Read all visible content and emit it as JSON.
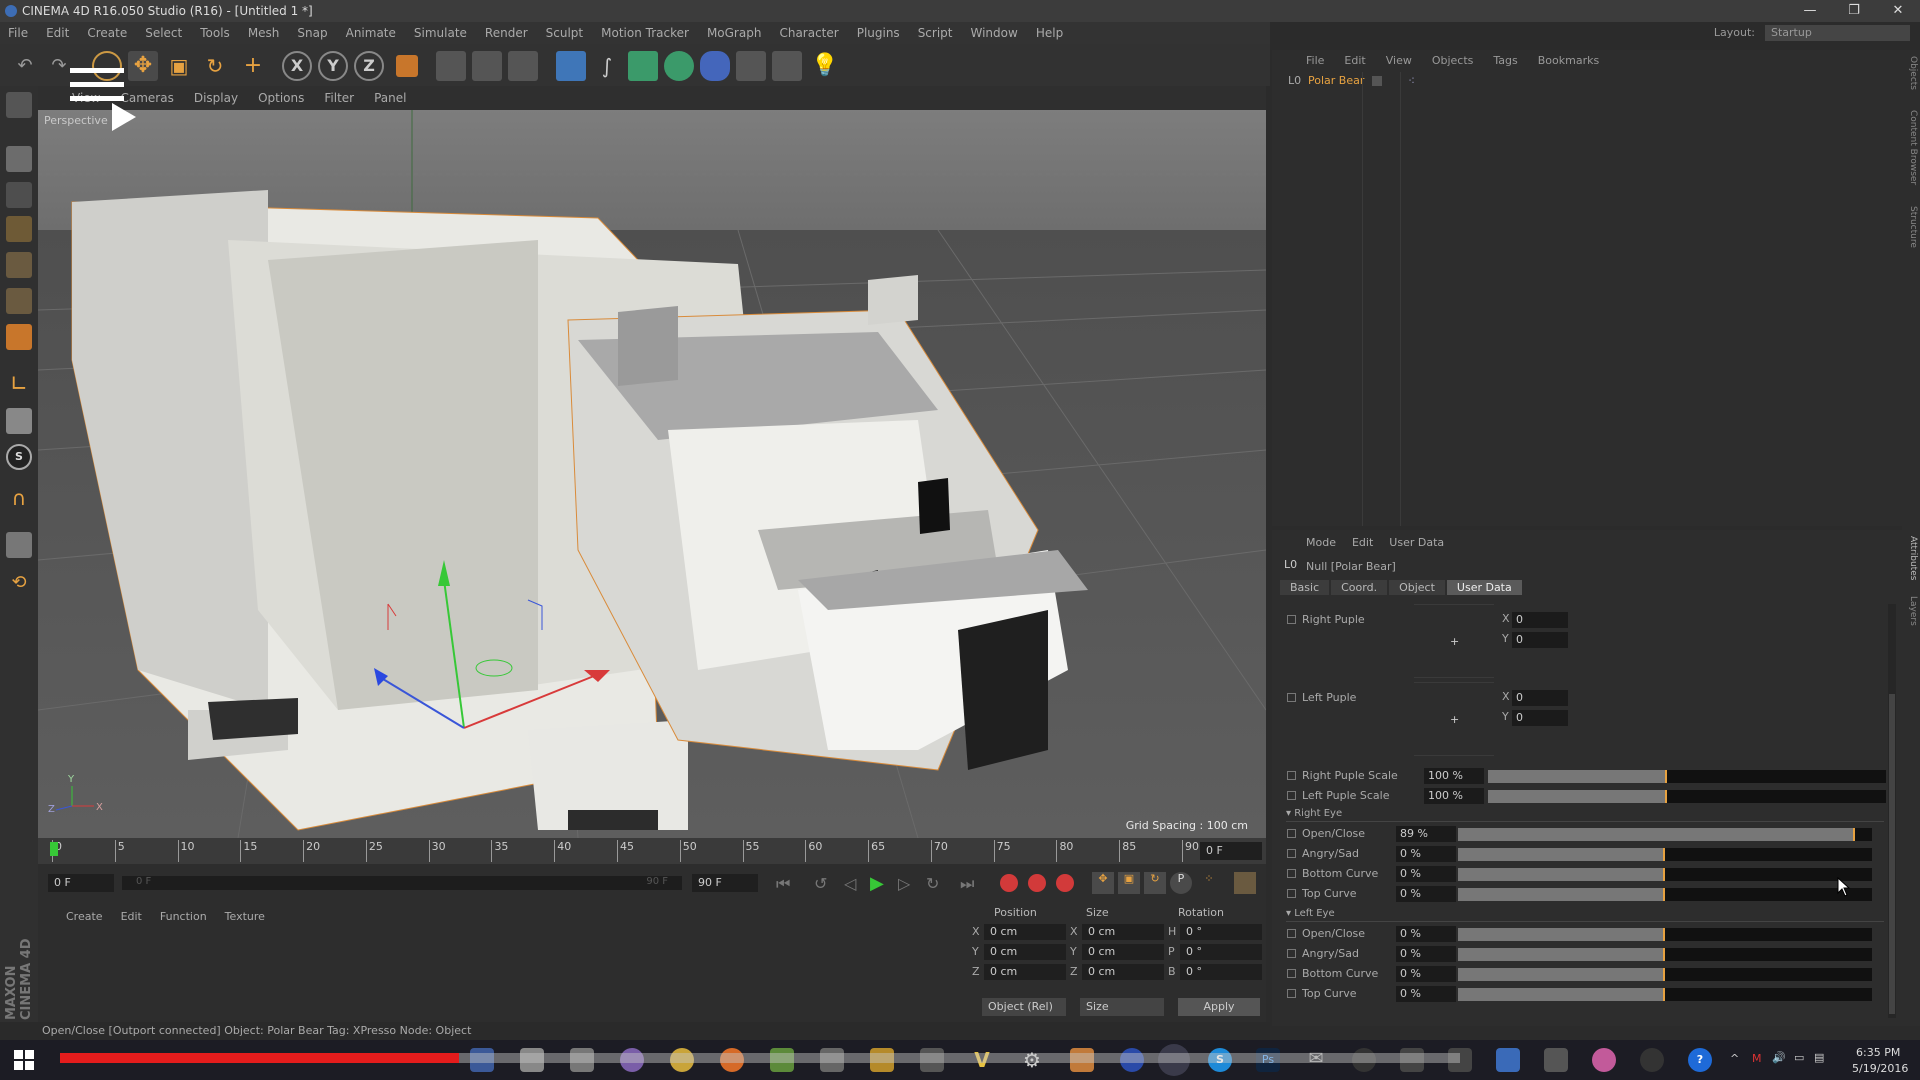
{
  "window": {
    "title": "CINEMA 4D R16.050 Studio (R16) - [Untitled 1 *]",
    "controls": [
      "—",
      "❐",
      "✕"
    ]
  },
  "menubar": [
    "File",
    "Edit",
    "Create",
    "Select",
    "Tools",
    "Mesh",
    "Snap",
    "Animate",
    "Simulate",
    "Render",
    "Sculpt",
    "Motion Tracker",
    "MoGraph",
    "Character",
    "Plugins",
    "Script",
    "Window",
    "Help"
  ],
  "layout": {
    "label": "Layout:",
    "value": "Startup"
  },
  "toolbar_axes": [
    "X",
    "Y",
    "Z"
  ],
  "viewport": {
    "menu": [
      "View",
      "Cameras",
      "Display",
      "Options",
      "Filter",
      "Panel"
    ],
    "label": "Perspective",
    "grid_spacing": "Grid Spacing : 100 cm",
    "axis_labels": [
      "Y",
      "Z",
      "X"
    ]
  },
  "timeline": {
    "ticks": [
      "0",
      "5",
      "10",
      "15",
      "20",
      "25",
      "30",
      "35",
      "40",
      "45",
      "50",
      "55",
      "60",
      "65",
      "70",
      "75",
      "80",
      "85",
      "90"
    ],
    "current_frame": "0 F",
    "start_field": "0 F",
    "min_field": "0 F",
    "max_field": "90 F",
    "end_field": "90 F"
  },
  "material_menu": [
    "Create",
    "Edit",
    "Function",
    "Texture"
  ],
  "coords": {
    "headers": [
      "Position",
      "Size",
      "Rotation"
    ],
    "rows": [
      {
        "axis": "X",
        "pos": "0 cm",
        "size_axis": "X",
        "size": "0 cm",
        "rot_axis": "H",
        "rot": "0 °"
      },
      {
        "axis": "Y",
        "pos": "0 cm",
        "size_axis": "Y",
        "size": "0 cm",
        "rot_axis": "P",
        "rot": "0 °"
      },
      {
        "axis": "Z",
        "pos": "0 cm",
        "size_axis": "Z",
        "size": "0 cm",
        "rot_axis": "B",
        "rot": "0 °"
      }
    ],
    "mode": "Object (Rel)",
    "size_mode": "Size",
    "apply": "Apply"
  },
  "brand": "MAXON CINEMA 4D",
  "status": "Open/Close [Outport connected] Object: Polar Bear Tag: XPresso Node: Object",
  "objects": {
    "menu": [
      "File",
      "Edit",
      "View",
      "Objects",
      "Tags",
      "Bookmarks"
    ],
    "items": [
      {
        "name": "Polar Bear"
      }
    ]
  },
  "attributes": {
    "menu": [
      "Mode",
      "Edit",
      "User Data"
    ],
    "object_title": "Null [Polar Bear]",
    "tabs": [
      "Basic",
      "Coord.",
      "Object",
      "User Data"
    ],
    "active_tab": "User Data",
    "pupils": [
      {
        "name": "Right Puple",
        "x": "0",
        "y": "0"
      },
      {
        "name": "Left Puple",
        "x": "0",
        "y": "0"
      }
    ],
    "scales": [
      {
        "name": "Right Puple Scale",
        "value": "100 %",
        "fraction": 0.45
      },
      {
        "name": "Left Puple Scale",
        "value": "100 %",
        "fraction": 0.45
      }
    ],
    "groups": [
      {
        "title": "Right Eye",
        "rows": [
          {
            "name": "Open/Close",
            "value": "89 %",
            "fraction": 0.96
          },
          {
            "name": "Angry/Sad",
            "value": "0 %",
            "fraction": 0.5
          },
          {
            "name": "Bottom Curve",
            "value": "0 %",
            "fraction": 0.5
          },
          {
            "name": "Top Curve",
            "value": "0 %",
            "fraction": 0.5
          }
        ]
      },
      {
        "title": "Left Eye",
        "rows": [
          {
            "name": "Open/Close",
            "value": "0 %",
            "fraction": 0.5
          },
          {
            "name": "Angry/Sad",
            "value": "0 %",
            "fraction": 0.5
          },
          {
            "name": "Bottom Curve",
            "value": "0 %",
            "fraction": 0.5
          },
          {
            "name": "Top Curve",
            "value": "0 %",
            "fraction": 0.5
          }
        ]
      }
    ]
  },
  "side_tabs": [
    "Objects",
    "Content Browser",
    "Structure",
    "Attributes",
    "Layers"
  ],
  "taskbar": {
    "time": "6:35 PM",
    "date": "5/19/2016"
  },
  "video_progress": 0.21
}
